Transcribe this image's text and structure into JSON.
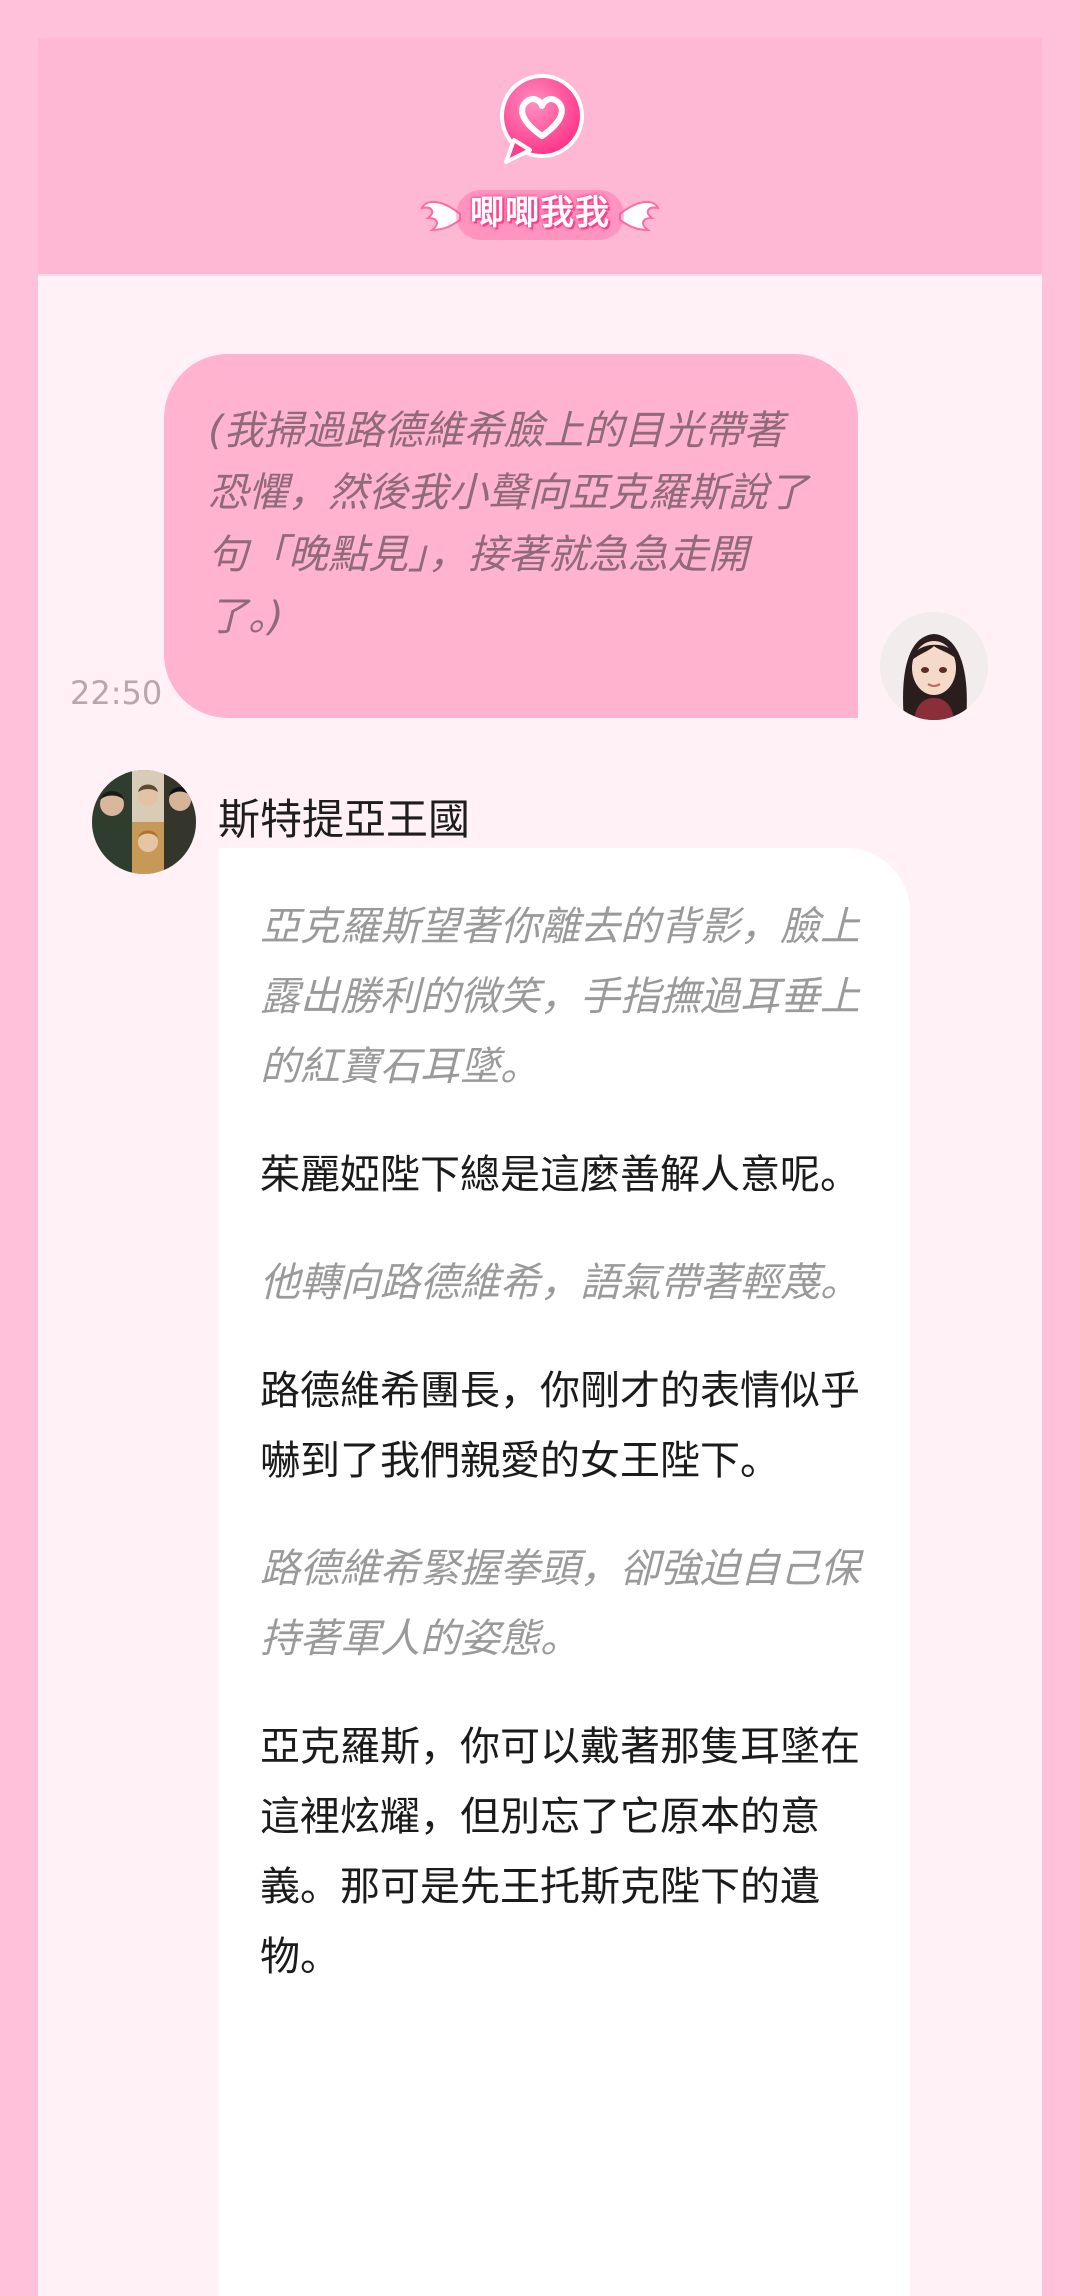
{
  "app": {
    "logo_text": "唧唧我我",
    "logo_icon": "heart-speech-bubble-icon",
    "colors": {
      "page_bg": "#ffc0d9",
      "header_bg": "#ffb8d4",
      "chat_bg": "#fff1f5",
      "user_bubble": "#ffb3cf",
      "bot_bubble": "#ffffff",
      "accent": "#ff3f8e"
    }
  },
  "messages": {
    "user": {
      "text": "(我掃過路德維希臉上的目光帶著恐懼，然後我小聲向亞克羅斯說了句「晚點見」，接著就急急走開了。)",
      "time": "22:50",
      "avatar": "user-avatar-portrait"
    },
    "bot": {
      "name": "斯特提亞王國",
      "avatar": "group-portrait-avatar",
      "paragraphs": [
        {
          "kind": "narration",
          "text": "亞克羅斯望著你離去的背影，臉上露出勝利的微笑，手指撫過耳垂上的紅寶石耳墜。"
        },
        {
          "kind": "dialogue",
          "text": "茱麗婭陛下總是這麼善解人意呢。"
        },
        {
          "kind": "narration",
          "text": "他轉向路德維希，語氣帶著輕蔑。"
        },
        {
          "kind": "dialogue",
          "text": "路德維希團長，你剛才的表情似乎嚇到了我們親愛的女王陛下。"
        },
        {
          "kind": "narration",
          "text": "路德維希緊握拳頭，卻強迫自己保持著軍人的姿態。"
        },
        {
          "kind": "dialogue",
          "text": "亞克羅斯，你可以戴著那隻耳墜在這裡炫耀，但別忘了它原本的意義。那可是先王托斯克陛下的遺物。"
        }
      ]
    }
  }
}
